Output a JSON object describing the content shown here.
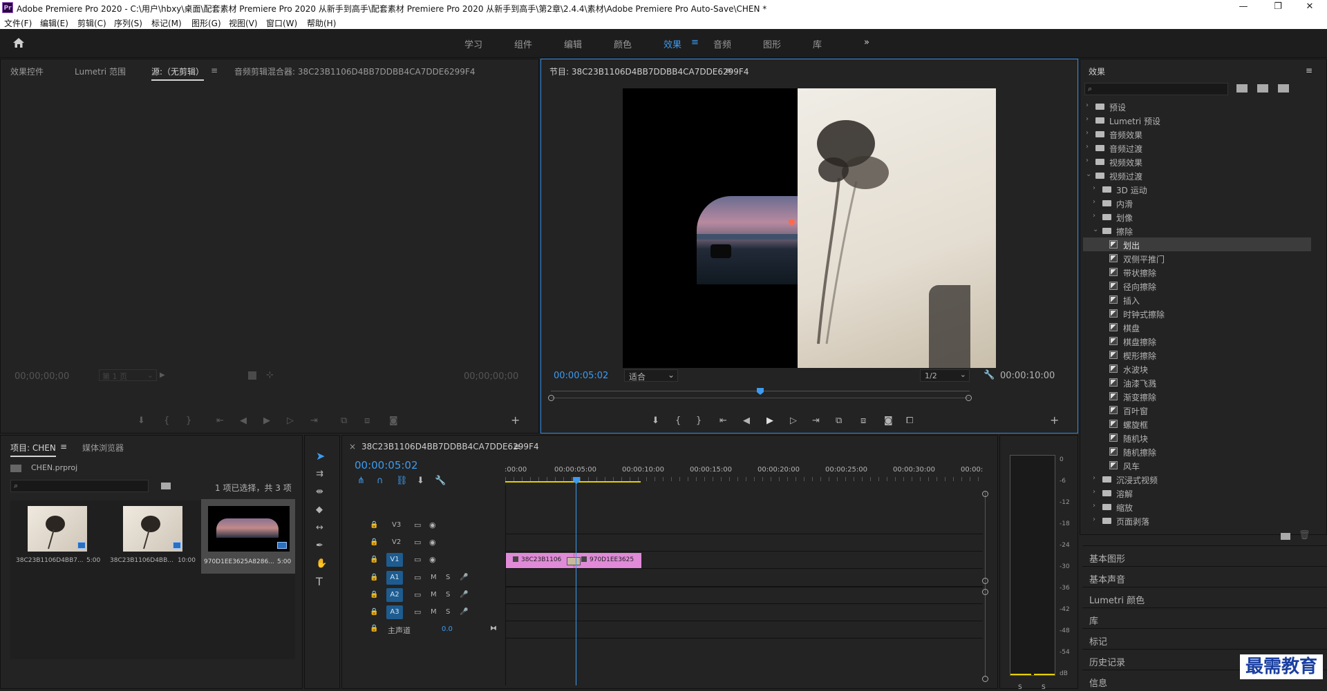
{
  "window": {
    "title": "Adobe Premiere Pro 2020 - C:\\用户\\hbxy\\桌面\\配套素材 Premiere Pro 2020 从新手到高手\\配套素材 Premiere Pro 2020 从新手到高手\\第2章\\2.4.4\\素材\\Adobe Premiere Pro Auto-Save\\CHEN *",
    "logo": "Pr",
    "minimize": "—",
    "maximize": "❐",
    "close": "✕"
  },
  "menu": [
    "文件(F)",
    "编辑(E)",
    "剪辑(C)",
    "序列(S)",
    "标记(M)",
    "图形(G)",
    "视图(V)",
    "窗口(W)",
    "帮助(H)"
  ],
  "workspaces": {
    "items": [
      "学习",
      "组件",
      "编辑",
      "颜色",
      "效果",
      "音频",
      "图形",
      "库"
    ],
    "active": "效果",
    "more": "»",
    "menu_icon": "≡"
  },
  "source_panel": {
    "tabs": [
      "效果控件",
      "Lumetri 范围",
      "源:（无剪辑）",
      "音频剪辑混合器: 38C23B1106D4BB7DDBB4CA7DDE6299F4"
    ],
    "tab_menu": "≡",
    "timecode_left": "00;00;00;00",
    "page_label": "第 1 页",
    "timecode_right": "00;00;00;00"
  },
  "program_panel": {
    "title": "节目: 38C23B1106D4BB7DDBB4CA7DDE6299F4",
    "menu": "≡",
    "timecode": "00:00:05:02",
    "fit": "适合",
    "resolution": "1/2",
    "duration": "00:00:10:00",
    "playhead_fraction": 0.5
  },
  "effects_panel": {
    "title": "效果",
    "menu": "≡",
    "search_placeholder": "",
    "tree": [
      {
        "label": "预设",
        "level": 0,
        "type": "folder-star",
        "expanded": false
      },
      {
        "label": "Lumetri 预设",
        "level": 0,
        "type": "folder-star",
        "expanded": false
      },
      {
        "label": "音频效果",
        "level": 0,
        "type": "folder",
        "expanded": false
      },
      {
        "label": "音频过渡",
        "level": 0,
        "type": "folder",
        "expanded": false
      },
      {
        "label": "视频效果",
        "level": 0,
        "type": "folder",
        "expanded": false
      },
      {
        "label": "视频过渡",
        "level": 0,
        "type": "folder",
        "expanded": true
      },
      {
        "label": "3D 运动",
        "level": 1,
        "type": "folder",
        "expanded": false
      },
      {
        "label": "内滑",
        "level": 1,
        "type": "folder",
        "expanded": false
      },
      {
        "label": "划像",
        "level": 1,
        "type": "folder",
        "expanded": false
      },
      {
        "label": "擦除",
        "level": 1,
        "type": "folder",
        "expanded": true
      },
      {
        "label": "划出",
        "level": 2,
        "type": "fx",
        "selected": true
      },
      {
        "label": "双侧平推门",
        "level": 2,
        "type": "fx"
      },
      {
        "label": "带状擦除",
        "level": 2,
        "type": "fx"
      },
      {
        "label": "径向擦除",
        "level": 2,
        "type": "fx"
      },
      {
        "label": "插入",
        "level": 2,
        "type": "fx"
      },
      {
        "label": "时钟式擦除",
        "level": 2,
        "type": "fx"
      },
      {
        "label": "棋盘",
        "level": 2,
        "type": "fx"
      },
      {
        "label": "棋盘擦除",
        "level": 2,
        "type": "fx"
      },
      {
        "label": "楔形擦除",
        "level": 2,
        "type": "fx"
      },
      {
        "label": "水波块",
        "level": 2,
        "type": "fx"
      },
      {
        "label": "油漆飞溅",
        "level": 2,
        "type": "fx"
      },
      {
        "label": "渐变擦除",
        "level": 2,
        "type": "fx"
      },
      {
        "label": "百叶窗",
        "level": 2,
        "type": "fx"
      },
      {
        "label": "螺旋框",
        "level": 2,
        "type": "fx"
      },
      {
        "label": "随机块",
        "level": 2,
        "type": "fx"
      },
      {
        "label": "随机擦除",
        "level": 2,
        "type": "fx"
      },
      {
        "label": "风车",
        "level": 2,
        "type": "fx"
      },
      {
        "label": "沉浸式视频",
        "level": 1,
        "type": "folder",
        "expanded": false
      },
      {
        "label": "溶解",
        "level": 1,
        "type": "folder",
        "expanded": false
      },
      {
        "label": "缩放",
        "level": 1,
        "type": "folder",
        "expanded": false
      },
      {
        "label": "页面剥落",
        "level": 1,
        "type": "folder",
        "expanded": false
      }
    ],
    "collapsed_panels": [
      "基本图形",
      "基本声音",
      "Lumetri 颜色",
      "库",
      "标记",
      "历史记录",
      "信息"
    ]
  },
  "project_panel": {
    "tabs": [
      "项目: CHEN",
      "媒体浏览器"
    ],
    "menu": "≡",
    "project_file": "CHEN.prproj",
    "selection_info": "1 项已选择，共 3 项",
    "items": [
      {
        "name": "38C23B1106D4BB7...",
        "duration": "5:00",
        "kind": "shadow"
      },
      {
        "name": "38C23B1106D4BB...",
        "duration": "10:00",
        "kind": "shadow"
      },
      {
        "name": "970D1EE3625A8286...",
        "duration": "5:00",
        "kind": "car",
        "selected": true
      }
    ]
  },
  "timeline": {
    "close": "×",
    "sequence_name": "38C23B1106D4BB7DDBB4CA7DDE6299F4",
    "menu": "≡",
    "timecode": "00:00:05:02",
    "ruler": [
      ":00:00",
      "00:00:05:00",
      "00:00:10:00",
      "00:00:15:00",
      "00:00:20:00",
      "00:00:25:00",
      "00:00:30:00",
      "00:00:"
    ],
    "video_tracks": [
      "V3",
      "V2",
      "V1"
    ],
    "audio_tracks": [
      "A1",
      "A2",
      "A3"
    ],
    "mute": "M",
    "solo": "S",
    "master": {
      "label": "主声道",
      "value": "0.0"
    },
    "clips": [
      {
        "name": "38C23B1106",
        "track": "V1"
      },
      {
        "name": "970D1EE3625",
        "track": "V1"
      }
    ]
  },
  "audio_meter": {
    "scale": [
      "0",
      "-6",
      "-12",
      "-18",
      "-24",
      "-30",
      "-36",
      "-42",
      "-48",
      "-54",
      "dB"
    ],
    "channels": [
      "S",
      "S"
    ]
  },
  "watermark": "最需教育",
  "colors": {
    "accent": "#3d9bf0",
    "clip": "#e08ad8",
    "panel": "#232323",
    "work_area": "#e5d000"
  }
}
